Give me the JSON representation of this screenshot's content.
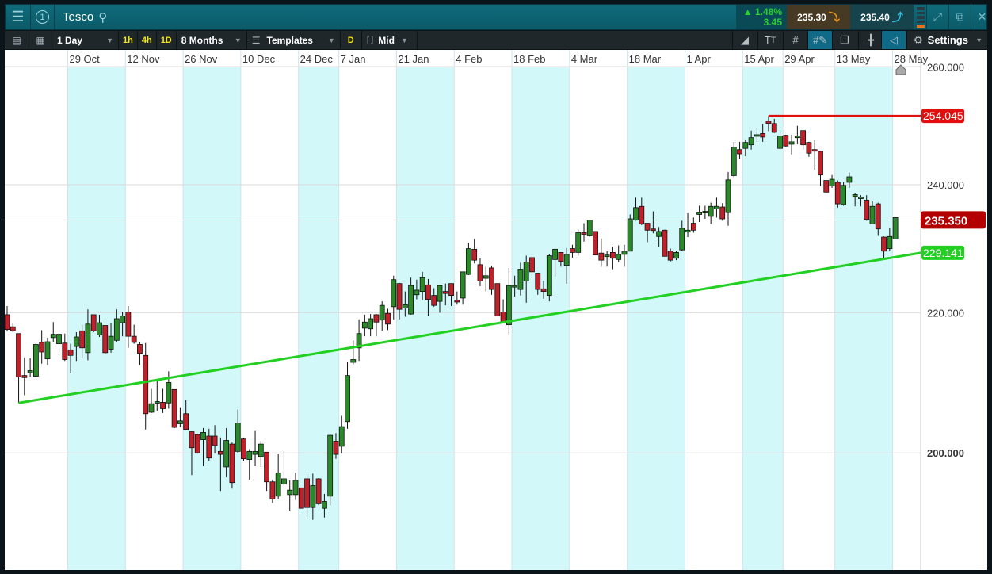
{
  "header": {
    "title": "Tesco",
    "menu_icon": "hamburger-icon",
    "workspace_number": "1",
    "search_icon": "search-icon",
    "change_percent": "1.48%",
    "change_value": "3.45",
    "sell_price": "235.30",
    "buy_price": "235.40",
    "colors": {
      "up": "#27d02b",
      "sell_arrow": "#e8961c",
      "buy_arrow": "#2cc0e0"
    }
  },
  "toolbar": {
    "interval": "1 Day",
    "quick_intervals": [
      "1h",
      "4h",
      "1D"
    ],
    "range": "8 Months",
    "templates": "Templates",
    "d_badge": "D",
    "price_type": "Mid",
    "settings": "Settings"
  },
  "chart_data": {
    "type": "candlestick",
    "instrument": "Tesco",
    "scale": "log",
    "x_tick_labels": [
      {
        "label": "29 Oct",
        "index": 11
      },
      {
        "label": "12 Nov",
        "index": 21
      },
      {
        "label": "26 Nov",
        "index": 31
      },
      {
        "label": "10 Dec",
        "index": 41
      },
      {
        "label": "24 Dec",
        "index": 51
      },
      {
        "label": "7 Jan",
        "index": 58
      },
      {
        "label": "21 Jan",
        "index": 68
      },
      {
        "label": "4 Feb",
        "index": 78
      },
      {
        "label": "18 Feb",
        "index": 88
      },
      {
        "label": "4 Mar",
        "index": 98
      },
      {
        "label": "18 Mar",
        "index": 108
      },
      {
        "label": "1 Apr",
        "index": 118
      },
      {
        "label": "15 Apr",
        "index": 128
      },
      {
        "label": "29 Apr",
        "index": 135
      },
      {
        "label": "13 May",
        "index": 144
      },
      {
        "label": "28 May",
        "index": 154
      }
    ],
    "y_ticks": [
      {
        "value": 260,
        "label": "260.000"
      },
      {
        "value": 240,
        "label": "240.000"
      },
      {
        "value": 220,
        "label": "220.000"
      },
      {
        "value": 200,
        "label": "200.000",
        "bold": true
      }
    ],
    "current_price": {
      "label": "235.350",
      "color": "#b30000"
    },
    "resistance_line": {
      "label": "254.045",
      "from_index": 132,
      "color": "#e01010"
    },
    "trend_line": {
      "label": "229.141",
      "value_at_axis": 229.141,
      "from_index": 2,
      "color": "#22d022"
    },
    "colors": {
      "up": "#2a8a2a",
      "down": "#c0202a",
      "band": "#d3f8fa"
    },
    "ohlc": [
      [
        219.7,
        221.0,
        217.2,
        217.5
      ],
      [
        217.9,
        218.4,
        217.1,
        217.3
      ],
      [
        216.9,
        216.9,
        206.9,
        210.6
      ],
      [
        210.8,
        213.4,
        208.0,
        210.5
      ],
      [
        211.2,
        213.3,
        210.6,
        211.5
      ],
      [
        210.7,
        215.5,
        210.5,
        215.3
      ],
      [
        215.6,
        217.4,
        212.5,
        214.2
      ],
      [
        213.2,
        216.3,
        212.3,
        215.7
      ],
      [
        216.3,
        218.6,
        215.6,
        216.8
      ],
      [
        215.4,
        217.4,
        214.0,
        216.8
      ],
      [
        215.5,
        216.9,
        212.9,
        213.1
      ],
      [
        214.5,
        215.4,
        211.1,
        213.7
      ],
      [
        215.0,
        217.1,
        212.9,
        216.4
      ],
      [
        217.3,
        218.2,
        213.3,
        214.8
      ],
      [
        214.1,
        220.5,
        213.0,
        218.3
      ],
      [
        219.7,
        219.7,
        217.1,
        217.3
      ],
      [
        216.7,
        219.7,
        216.4,
        218.5
      ],
      [
        218.1,
        218.1,
        214.0,
        214.1
      ],
      [
        214.6,
        218.4,
        214.1,
        216.5
      ],
      [
        215.9,
        220.5,
        215.6,
        219.1
      ],
      [
        218.5,
        220.1,
        216.5,
        219.5
      ],
      [
        220.1,
        221.0,
        214.8,
        216.5
      ],
      [
        216.5,
        218.2,
        215.4,
        215.6
      ],
      [
        215.3,
        215.6,
        212.3,
        214.0
      ],
      [
        213.7,
        215.5,
        203.2,
        205.4
      ],
      [
        205.6,
        208.9,
        205.5,
        206.8
      ],
      [
        206.9,
        210.0,
        205.8,
        207.1
      ],
      [
        207.0,
        208.9,
        205.5,
        206.1
      ],
      [
        206.9,
        211.4,
        206.1,
        209.8
      ],
      [
        208.8,
        208.8,
        203.4,
        203.5
      ],
      [
        204.0,
        206.3,
        203.5,
        204.4
      ],
      [
        205.4,
        207.3,
        203.1,
        203.2
      ],
      [
        202.9,
        202.9,
        197.0,
        200.7
      ],
      [
        202.5,
        202.6,
        199.9,
        200.0
      ],
      [
        201.8,
        203.4,
        198.2,
        202.8
      ],
      [
        202.3,
        203.3,
        198.9,
        199.3
      ],
      [
        202.3,
        203.8,
        199.9,
        201.0
      ],
      [
        200.2,
        202.1,
        194.9,
        199.8
      ],
      [
        198.1,
        203.4,
        196.7,
        201.7
      ],
      [
        201.2,
        201.4,
        195.2,
        196.0
      ],
      [
        200.2,
        206.0,
        200.0,
        204.1
      ],
      [
        201.9,
        202.1,
        198.9,
        199.2
      ],
      [
        199.1,
        200.5,
        196.4,
        200.2
      ],
      [
        199.8,
        203.0,
        198.2,
        200.2
      ],
      [
        199.5,
        201.6,
        198.1,
        201.2
      ],
      [
        200.1,
        200.1,
        194.9,
        196.1
      ],
      [
        196.1,
        196.4,
        193.3,
        193.8
      ],
      [
        194.2,
        199.8,
        193.8,
        197.3
      ],
      [
        195.8,
        200.3,
        195.4,
        196.5
      ],
      [
        194.4,
        196.3,
        192.3,
        195.0
      ],
      [
        194.4,
        197.3,
        193.7,
        196.3
      ],
      [
        195.3,
        195.3,
        192.6,
        192.6
      ],
      [
        196.5,
        197.1,
        191.2,
        192.7
      ],
      [
        192.7,
        197.2,
        191.1,
        195.6
      ],
      [
        196.5,
        196.6,
        193.0,
        193.2
      ],
      [
        192.6,
        194.5,
        191.4,
        193.5
      ],
      [
        194.2,
        202.5,
        193.0,
        202.4
      ],
      [
        201.6,
        202.7,
        199.2,
        199.8
      ],
      [
        200.9,
        205.1,
        199.9,
        203.6
      ],
      [
        204.3,
        212.8,
        203.3,
        210.8
      ],
      [
        212.7,
        215.9,
        212.4,
        213.1
      ],
      [
        214.8,
        219.0,
        212.9,
        216.9
      ],
      [
        217.7,
        219.7,
        216.5,
        218.6
      ],
      [
        217.6,
        219.8,
        216.5,
        219.1
      ],
      [
        219.7,
        219.8,
        216.5,
        218.6
      ],
      [
        218.9,
        221.7,
        217.3,
        221.1
      ],
      [
        219.9,
        220.6,
        217.4,
        218.3
      ],
      [
        220.9,
        225.6,
        219.0,
        225.0
      ],
      [
        224.4,
        224.5,
        219.0,
        220.5
      ],
      [
        220.7,
        223.2,
        219.4,
        221.2
      ],
      [
        219.8,
        225.3,
        219.7,
        224.1
      ],
      [
        222.7,
        225.0,
        222.0,
        223.4
      ],
      [
        223.2,
        226.2,
        221.9,
        225.3
      ],
      [
        224.2,
        225.1,
        219.5,
        222.0
      ],
      [
        222.6,
        223.7,
        220.9,
        221.1
      ],
      [
        221.7,
        224.2,
        220.0,
        224.1
      ],
      [
        223.2,
        224.4,
        221.1,
        222.9
      ],
      [
        224.4,
        224.4,
        221.0,
        222.6
      ],
      [
        221.9,
        223.2,
        221.2,
        221.6
      ],
      [
        222.2,
        226.2,
        221.2,
        226.2
      ],
      [
        225.8,
        230.7,
        225.7,
        229.8
      ],
      [
        229.7,
        231.3,
        227.5,
        228.0
      ],
      [
        227.3,
        228.3,
        224.0,
        224.8
      ],
      [
        225.2,
        227.0,
        223.2,
        225.6
      ],
      [
        226.8,
        227.1,
        222.7,
        223.5
      ],
      [
        224.4,
        224.4,
        219.5,
        219.5
      ],
      [
        220.1,
        222.0,
        218.6,
        218.6
      ],
      [
        218.2,
        226.8,
        216.6,
        224.1
      ],
      [
        224.0,
        225.6,
        222.4,
        224.1
      ],
      [
        223.5,
        227.6,
        222.6,
        226.6
      ],
      [
        224.8,
        228.7,
        221.5,
        227.7
      ],
      [
        228.4,
        228.9,
        225.2,
        226.2
      ],
      [
        226.0,
        226.0,
        222.7,
        223.5
      ],
      [
        223.6,
        224.8,
        222.1,
        223.2
      ],
      [
        222.6,
        228.9,
        221.7,
        228.7
      ],
      [
        228.1,
        229.8,
        225.5,
        229.7
      ],
      [
        229.2,
        229.2,
        227.0,
        227.8
      ],
      [
        227.2,
        229.9,
        224.4,
        228.9
      ],
      [
        229.8,
        230.4,
        228.4,
        229.2
      ],
      [
        229.2,
        232.8,
        228.7,
        232.3
      ],
      [
        232.3,
        233.8,
        230.9,
        232.2
      ],
      [
        231.8,
        234.3,
        231.7,
        234.3
      ],
      [
        232.5,
        232.5,
        228.8,
        228.8
      ],
      [
        229.1,
        231.4,
        227.0,
        228.0
      ],
      [
        228.7,
        229.4,
        227.0,
        228.8
      ],
      [
        229.2,
        230.1,
        226.6,
        228.3
      ],
      [
        228.1,
        230.3,
        227.7,
        228.9
      ],
      [
        228.9,
        230.4,
        227.0,
        229.4
      ],
      [
        229.4,
        235.2,
        229.4,
        234.5
      ],
      [
        234.3,
        237.9,
        234.2,
        236.3
      ],
      [
        236.5,
        237.9,
        233.5,
        233.7
      ],
      [
        233.8,
        233.8,
        230.8,
        232.7
      ],
      [
        232.9,
        235.7,
        232.2,
        232.8
      ],
      [
        231.7,
        233.2,
        230.1,
        232.5
      ],
      [
        232.7,
        232.8,
        228.6,
        228.6
      ],
      [
        229.4,
        229.8,
        227.8,
        228.0
      ],
      [
        228.3,
        229.4,
        228.0,
        229.2
      ],
      [
        229.6,
        234.2,
        229.4,
        233.0
      ],
      [
        232.4,
        235.4,
        231.6,
        232.7
      ],
      [
        233.8,
        234.7,
        232.3,
        232.7
      ],
      [
        235.2,
        236.6,
        234.0,
        235.5
      ],
      [
        235.5,
        236.6,
        234.5,
        235.7
      ],
      [
        234.9,
        237.1,
        233.7,
        236.5
      ],
      [
        236.1,
        237.9,
        234.7,
        236.5
      ],
      [
        236.4,
        237.0,
        234.2,
        234.5
      ],
      [
        235.5,
        242.1,
        233.4,
        240.8
      ],
      [
        241.5,
        247.1,
        241.2,
        246.2
      ],
      [
        245.8,
        247.1,
        244.3,
        245.1
      ],
      [
        246.0,
        247.5,
        244.7,
        247.0
      ],
      [
        246.6,
        249.0,
        245.8,
        247.8
      ],
      [
        248.1,
        249.5,
        247.1,
        248.3
      ],
      [
        248.5,
        250.1,
        247.1,
        247.9
      ],
      [
        250.6,
        251.5,
        248.9,
        250.2
      ],
      [
        250.2,
        251.0,
        248.6,
        248.7
      ],
      [
        246.0,
        248.7,
        245.8,
        248.1
      ],
      [
        248.2,
        248.3,
        246.3,
        246.4
      ],
      [
        246.7,
        248.3,
        245.0,
        247.1
      ],
      [
        247.8,
        249.8,
        246.7,
        248.1
      ],
      [
        249.0,
        249.0,
        245.8,
        246.6
      ],
      [
        247.0,
        247.1,
        244.6,
        245.2
      ],
      [
        245.8,
        247.4,
        242.5,
        245.6
      ],
      [
        245.5,
        245.6,
        239.8,
        241.6
      ],
      [
        240.7,
        240.7,
        238.8,
        238.8
      ],
      [
        239.8,
        241.6,
        239.5,
        240.9
      ],
      [
        240.4,
        240.7,
        236.3,
        236.9
      ],
      [
        236.8,
        240.4,
        236.6,
        239.9
      ],
      [
        240.4,
        242.0,
        239.5,
        241.3
      ],
      [
        238.1,
        238.6,
        236.5,
        238.4
      ],
      [
        237.8,
        238.3,
        236.5,
        238.0
      ],
      [
        237.5,
        238.3,
        234.2,
        234.4
      ],
      [
        233.7,
        237.3,
        233.7,
        236.5
      ],
      [
        236.9,
        237.1,
        231.8,
        232.9
      ],
      [
        231.6,
        231.7,
        228.2,
        229.4
      ],
      [
        229.8,
        233.0,
        229.4,
        231.7
      ],
      [
        231.3,
        234.7,
        231.3,
        234.7
      ]
    ]
  }
}
